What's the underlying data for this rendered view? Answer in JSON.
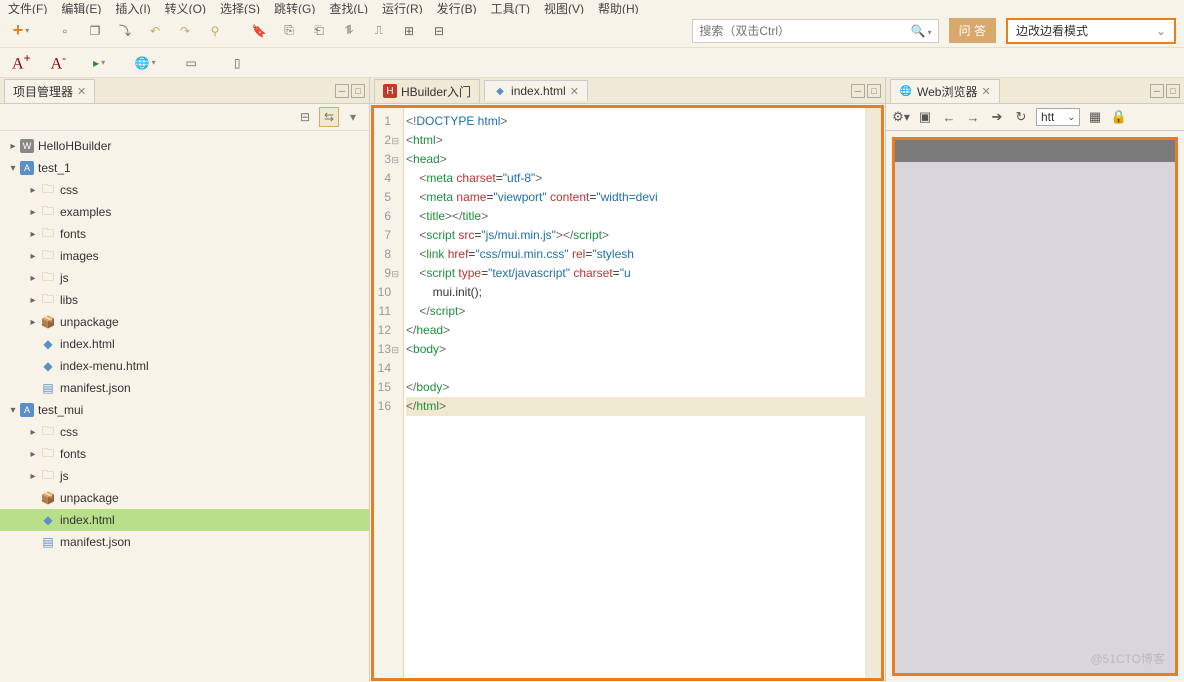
{
  "menu": [
    "文件(F)",
    "编辑(E)",
    "插入(I)",
    "转义(O)",
    "选择(S)",
    "跳转(G)",
    "查找(L)",
    "运行(R)",
    "发行(B)",
    "工具(T)",
    "视图(V)",
    "帮助(H)"
  ],
  "search_placeholder": "搜索（双击Ctrl）",
  "ask_btn": "问 答",
  "mode_label": "边改边看模式",
  "panels": {
    "project_manager": "项目管理器",
    "web_browser": "Web浏览器"
  },
  "tree": [
    {
      "d": 0,
      "tw": "▸",
      "ic": "w",
      "label": "HelloHBuilder"
    },
    {
      "d": 0,
      "tw": "▾",
      "ic": "proj",
      "label": "test_1"
    },
    {
      "d": 1,
      "tw": "▸",
      "ic": "folder",
      "label": "css"
    },
    {
      "d": 1,
      "tw": "▸",
      "ic": "folder",
      "label": "examples"
    },
    {
      "d": 1,
      "tw": "▸",
      "ic": "folder",
      "label": "fonts"
    },
    {
      "d": 1,
      "tw": "▸",
      "ic": "folder",
      "label": "images"
    },
    {
      "d": 1,
      "tw": "▸",
      "ic": "folder",
      "label": "js"
    },
    {
      "d": 1,
      "tw": "▸",
      "ic": "folder",
      "label": "libs"
    },
    {
      "d": 1,
      "tw": "▸",
      "ic": "pkg",
      "label": "unpackage"
    },
    {
      "d": 1,
      "tw": "",
      "ic": "html",
      "label": "index.html"
    },
    {
      "d": 1,
      "tw": "",
      "ic": "html",
      "label": "index-menu.html"
    },
    {
      "d": 1,
      "tw": "",
      "ic": "json",
      "label": "manifest.json"
    },
    {
      "d": 0,
      "tw": "▾",
      "ic": "proj",
      "label": "test_mui"
    },
    {
      "d": 1,
      "tw": "▸",
      "ic": "folder",
      "label": "css"
    },
    {
      "d": 1,
      "tw": "▸",
      "ic": "folder",
      "label": "fonts"
    },
    {
      "d": 1,
      "tw": "▸",
      "ic": "folder",
      "label": "js"
    },
    {
      "d": 1,
      "tw": "",
      "ic": "pkg",
      "label": "unpackage"
    },
    {
      "d": 1,
      "tw": "",
      "ic": "html",
      "label": "index.html",
      "sel": true
    },
    {
      "d": 1,
      "tw": "",
      "ic": "json",
      "label": "manifest.json"
    }
  ],
  "editor_tabs": [
    {
      "icon": "H",
      "label": "HBuilder入门",
      "active": false
    },
    {
      "icon": "html",
      "label": "index.html",
      "active": true
    }
  ],
  "code_lines": [
    {
      "n": 1,
      "f": "",
      "html": "<span class='t-punc'>&lt;!</span><span class='t-doctype'>DOCTYPE html</span><span class='t-punc'>&gt;</span>"
    },
    {
      "n": 2,
      "f": "⊟",
      "html": "<span class='t-punc'>&lt;</span><span class='t-tag'>html</span><span class='t-punc'>&gt;</span>"
    },
    {
      "n": 3,
      "f": "⊟",
      "html": "<span class='t-punc'>&lt;</span><span class='t-tag'>head</span><span class='t-punc'>&gt;</span>"
    },
    {
      "n": 4,
      "f": "",
      "html": "    <span class='t-punc'>&lt;</span><span class='t-tag'>meta</span> <span class='t-attr'>charset</span>=<span class='t-str'>\"utf-8\"</span><span class='t-punc'>&gt;</span>"
    },
    {
      "n": 5,
      "f": "",
      "html": "    <span class='t-punc'>&lt;</span><span class='t-tag'>meta</span> <span class='t-attr'>name</span>=<span class='t-str'>\"viewport\"</span> <span class='t-attr'>content</span>=<span class='t-str'>\"width=devi</span>"
    },
    {
      "n": 6,
      "f": "",
      "html": "    <span class='t-punc'>&lt;</span><span class='t-tag'>title</span><span class='t-punc'>&gt;&lt;/</span><span class='t-tag'>title</span><span class='t-punc'>&gt;</span>"
    },
    {
      "n": 7,
      "f": "",
      "html": "    <span class='t-punc'>&lt;</span><span class='t-tag'>script</span> <span class='t-attr'>src</span>=<span class='t-str'>\"js/mui.min.js\"</span><span class='t-punc'>&gt;&lt;/</span><span class='t-tag'>script</span><span class='t-punc'>&gt;</span>"
    },
    {
      "n": 8,
      "f": "",
      "html": "    <span class='t-punc'>&lt;</span><span class='t-tag'>link</span> <span class='t-attr'>href</span>=<span class='t-str'>\"css/mui.min.css\"</span> <span class='t-attr'>rel</span>=<span class='t-str'>\"stylesh</span>"
    },
    {
      "n": 9,
      "f": "⊟",
      "html": "    <span class='t-punc'>&lt;</span><span class='t-tag'>script</span> <span class='t-attr'>type</span>=<span class='t-str'>\"text/javascript\"</span> <span class='t-attr'>charset</span>=<span class='t-str'>\"u</span>"
    },
    {
      "n": 10,
      "f": "",
      "html": "        mui.init();"
    },
    {
      "n": 11,
      "f": "",
      "html": "    <span class='t-punc'>&lt;/</span><span class='t-tag'>script</span><span class='t-punc'>&gt;</span>"
    },
    {
      "n": 12,
      "f": "",
      "html": "<span class='t-punc'>&lt;/</span><span class='t-tag'>head</span><span class='t-punc'>&gt;</span>"
    },
    {
      "n": 13,
      "f": "⊟",
      "html": "<span class='t-punc'>&lt;</span><span class='t-tag'>body</span><span class='t-punc'>&gt;</span>"
    },
    {
      "n": 14,
      "f": "",
      "html": ""
    },
    {
      "n": 15,
      "f": "",
      "html": "<span class='t-punc'>&lt;/</span><span class='t-tag'>body</span><span class='t-punc'>&gt;</span>"
    },
    {
      "n": 16,
      "f": "",
      "hl": true,
      "html": "<span class='t-punc'>&lt;/</span><span class='t-tag'>html</span><span class='t-punc'>&gt;</span>"
    }
  ],
  "url_box": "htt",
  "watermark": "@51CTO博客"
}
